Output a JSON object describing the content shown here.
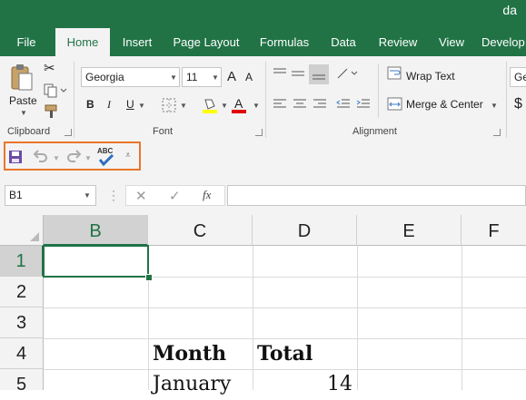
{
  "window": {
    "title": "da"
  },
  "tabs": [
    {
      "label": "File"
    },
    {
      "label": "Home"
    },
    {
      "label": "Insert"
    },
    {
      "label": "Page Layout"
    },
    {
      "label": "Formulas"
    },
    {
      "label": "Data"
    },
    {
      "label": "Review"
    },
    {
      "label": "View"
    },
    {
      "label": "Develop"
    }
  ],
  "ribbon": {
    "clipboard": {
      "paste_label": "Paste",
      "group_label": "Clipboard"
    },
    "font": {
      "family": "Georgia",
      "size": "11",
      "bold": "B",
      "italic": "I",
      "underline": "U",
      "grow": "A",
      "shrink": "A",
      "font_color_letter": "A",
      "group_label": "Font"
    },
    "alignment": {
      "wrap_text": "Wrap Text",
      "merge_center": "Merge & Center",
      "group_label": "Alignment"
    },
    "number": {
      "currency": "$",
      "format_partial": "Ge"
    }
  },
  "qat": {
    "spelling_label": "ABC"
  },
  "formula_bar": {
    "name_box": "B1",
    "fx": "fx",
    "formula": ""
  },
  "sheet": {
    "columns": [
      "B",
      "C",
      "D",
      "E",
      "F"
    ],
    "rows": [
      "1",
      "2",
      "3",
      "4",
      "5"
    ],
    "selected_cell": "B1",
    "cells": {
      "C4": "Month",
      "D4": "Total",
      "C5": "January",
      "D5": "14"
    }
  },
  "colors": {
    "accent": "#217346",
    "highlight": "#e8762b"
  }
}
